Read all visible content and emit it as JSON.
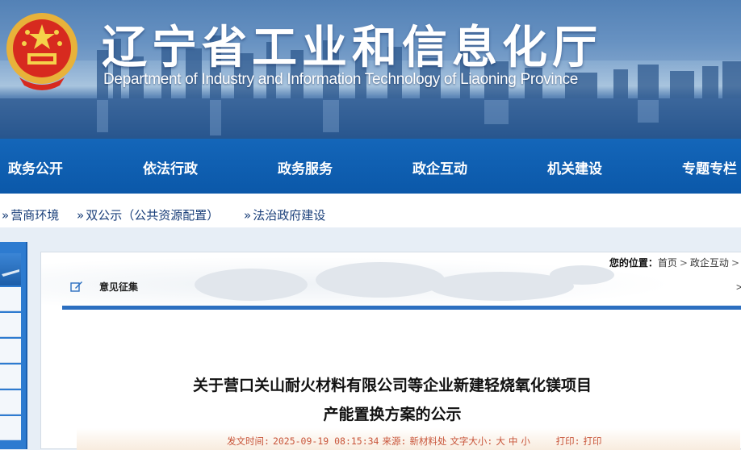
{
  "header": {
    "title": "辽宁省工业和信息化厅",
    "subtitle": "Department of Industry and Information Technology of Liaoning Province",
    "emblem": "national-emblem-icon"
  },
  "nav": {
    "items": [
      "政务公开",
      "依法行政",
      "政务服务",
      "政企互动",
      "机关建设",
      "专题专栏"
    ]
  },
  "subnav": {
    "items": [
      "营商环境",
      "双公示（公共资源配置）",
      "法治政府建设"
    ],
    "marker": "»"
  },
  "location": {
    "label": "您的位置：",
    "crumbs": [
      "首页",
      "政企互动"
    ],
    "sep": ">"
  },
  "tab": {
    "label": "意见征集",
    "icon": "edit-icon",
    "more": ">"
  },
  "article": {
    "title_line1": "关于营口关山耐火材料有限公司等企业新建轻烧氧化镁项目",
    "title_line2": "产能置换方案的公示",
    "date_label": "发文时间:",
    "date": "2025-09-19 08:15:34",
    "source_label": "来源:",
    "source": "新材料处",
    "font_label": "文字大小:",
    "font_big": "大",
    "font_mid": "中",
    "font_small": "小",
    "print_label": "打印:",
    "print": "打印"
  },
  "colors": {
    "nav_bg": "#0b58a9",
    "accent": "#2c6fc0",
    "meta_text": "#c8553a"
  }
}
